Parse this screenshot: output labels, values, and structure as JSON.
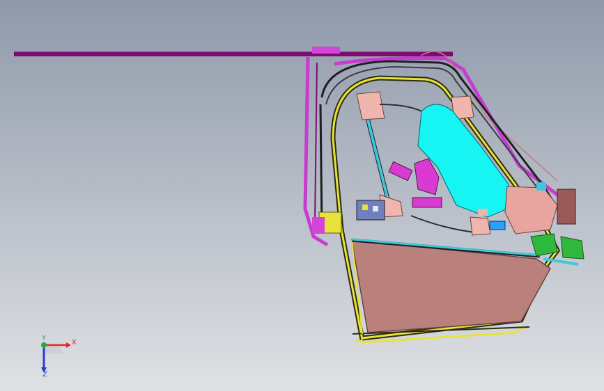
{
  "viewport": {
    "background_top": "#8f99aa",
    "background_bottom": "#dfe1e4"
  },
  "triad": {
    "x_label": "X",
    "y_label": "Y",
    "z_label": "Z",
    "x_color": "#e8262a",
    "y_color": "#29a745",
    "z_color": "#2b3bd8"
  },
  "parts": {
    "roof_rail": "#7a0d6e",
    "frame": "#c83bd0",
    "seal": "#e8e23a",
    "glass_channel": "#41c7d8",
    "door_trim": "#b9807c",
    "airbag": "#16f4f4",
    "regulator": "#f0b6ad",
    "motor": "#d93bd2",
    "connector": "#2fb83e",
    "guide": "#2aa0ff"
  }
}
